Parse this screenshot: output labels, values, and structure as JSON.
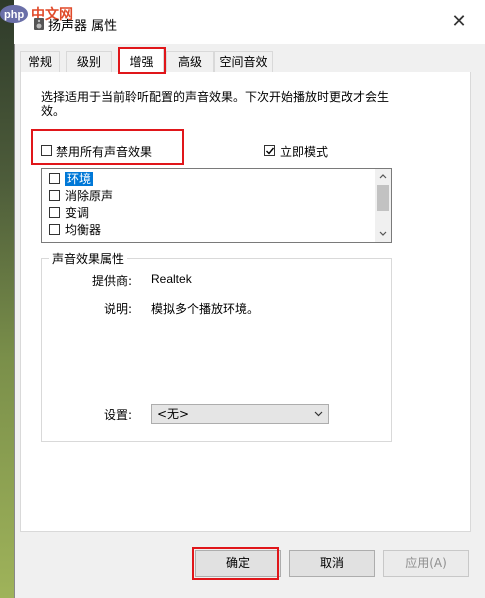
{
  "window": {
    "title": "扬声器 属性"
  },
  "watermark": {
    "text": "php中文网"
  },
  "tabs": [
    {
      "label": "常规"
    },
    {
      "label": "级别"
    },
    {
      "label": "增强"
    },
    {
      "label": "高级"
    },
    {
      "label": "空间音效"
    }
  ],
  "active_tab": "增强",
  "enhance": {
    "description": "选择适用于当前聆听配置的声音效果。下次开始播放时更改才会生效。",
    "disable_all_label": "禁用所有声音效果",
    "disable_all_checked": false,
    "immediate_mode_label": "立即模式",
    "immediate_mode_checked": true,
    "effects": [
      {
        "label": "环境",
        "checked": false,
        "selected": true
      },
      {
        "label": "消除原声",
        "checked": false,
        "selected": false
      },
      {
        "label": "变调",
        "checked": false,
        "selected": false
      },
      {
        "label": "均衡器",
        "checked": false,
        "selected": false
      }
    ]
  },
  "properties": {
    "group_title": "声音效果属性",
    "provider_label": "提供商:",
    "provider_value": "Realtek",
    "desc_label": "说明:",
    "desc_value": "模拟多个播放环境。",
    "settings_label": "设置:",
    "settings_value": "<无>"
  },
  "buttons": {
    "ok": "确定",
    "cancel": "取消",
    "apply": "应用(A)"
  },
  "colors": {
    "highlight_red": "#e0161a",
    "selection_blue": "#0078d7"
  }
}
